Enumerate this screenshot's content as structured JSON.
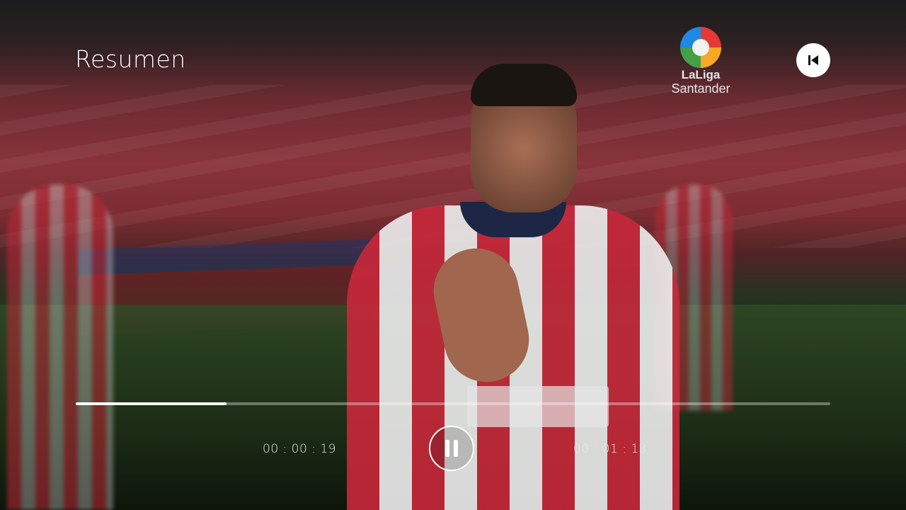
{
  "player": {
    "title": "Resumen",
    "logo": {
      "name": "LaLiga",
      "sub": "Santander"
    },
    "back_button_icon": "skip-previous-icon",
    "pause_button_icon": "pause-icon",
    "progress": 0.2,
    "time_elapsed": "00 : 00 : 19",
    "time_total": "00 : 01 : 18"
  },
  "colors": {
    "accent": "#ffffff",
    "track": "rgba(255,255,255,0.35)"
  }
}
